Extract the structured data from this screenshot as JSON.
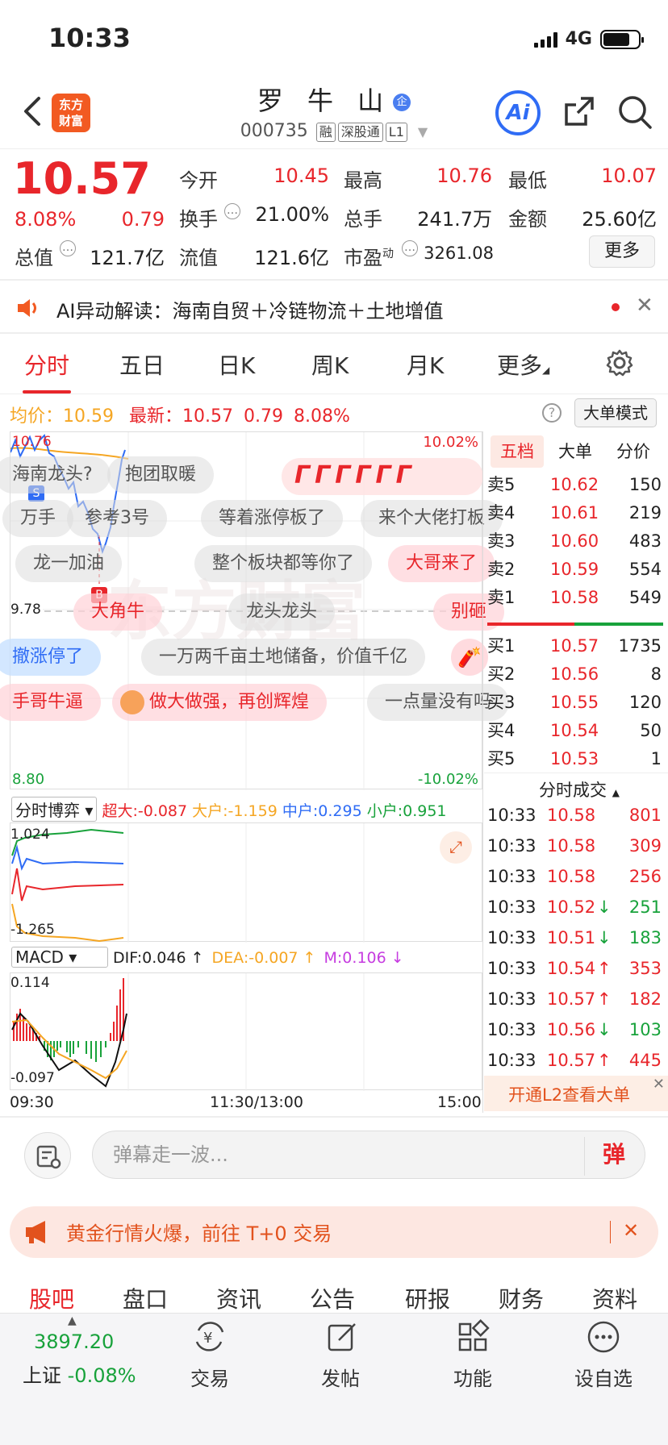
{
  "status": {
    "time": "10:33",
    "network": "4G"
  },
  "header": {
    "title": "罗 牛 山",
    "title_badge": "企",
    "code": "000735",
    "tags": [
      "融",
      "深股通",
      "L1"
    ],
    "logo_text_1": "东方",
    "logo_text_2": "财富",
    "ai_label": "Ai"
  },
  "quote": {
    "price": "10.57",
    "change_pct": "8.08%",
    "change": "0.79",
    "open_label": "今开",
    "open": "10.45",
    "high_label": "最高",
    "high": "10.76",
    "low_label": "最低",
    "low": "10.07",
    "turnover_label": "换手",
    "turnover": "21.00%",
    "volume_label": "总手",
    "volume": "241.7万",
    "amount_label": "金额",
    "amount": "25.60亿",
    "mktcap_label": "总值",
    "mktcap": "121.7亿",
    "float_label": "流值",
    "float": "121.6亿",
    "pe_label": "市盈",
    "pe_sup": "动",
    "pe": "3261.08",
    "more": "更多"
  },
  "ai_bar": {
    "text": "AI异动解读：海南自贸＋冷链物流＋土地增值"
  },
  "ktabs": [
    "分时",
    "五日",
    "日K",
    "周K",
    "月K",
    "更多"
  ],
  "avg": {
    "avg_label": "均价：",
    "avg": "10.59",
    "last_label": "最新：",
    "last": "10.57",
    "chg": "0.79",
    "pct": "8.08%",
    "big_mode": "大单模式"
  },
  "chart": {
    "high_label": "10.76",
    "up_limit": "10.02%",
    "prev_close": "9.78",
    "low_label": "8.80",
    "down_limit": "-10.02%",
    "markers": [
      "S",
      "B"
    ]
  },
  "danmu": [
    "海南龙头?",
    "抱团取暖",
    "万手",
    "参考3号",
    "等着涨停板了",
    "来个大佬打板",
    "龙一加油",
    "整个板块都等你了",
    "大哥来了",
    "大角牛",
    "龙头龙头",
    "别砸",
    "撤涨停了",
    "一万两千亩土地储备，价值千亿",
    "手哥牛逼",
    "做大做强，再创辉煌",
    "一点量没有吗"
  ],
  "orderbook": {
    "tabs": [
      "五档",
      "大单",
      "分价"
    ],
    "asks": [
      {
        "label": "卖5",
        "price": "10.62",
        "vol": "150"
      },
      {
        "label": "卖4",
        "price": "10.61",
        "vol": "219"
      },
      {
        "label": "卖3",
        "price": "10.60",
        "vol": "483"
      },
      {
        "label": "卖2",
        "price": "10.59",
        "vol": "554"
      },
      {
        "label": "卖1",
        "price": "10.58",
        "vol": "549"
      }
    ],
    "bids": [
      {
        "label": "买1",
        "price": "10.57",
        "vol": "1735"
      },
      {
        "label": "买2",
        "price": "10.56",
        "vol": "8"
      },
      {
        "label": "买3",
        "price": "10.55",
        "vol": "120"
      },
      {
        "label": "买4",
        "price": "10.54",
        "vol": "50"
      },
      {
        "label": "买5",
        "price": "10.53",
        "vol": "1"
      }
    ]
  },
  "trades": {
    "title": "分时成交",
    "rows": [
      {
        "time": "10:33",
        "price": "10.58",
        "dir": "",
        "vol": "801",
        "c": "red",
        "vc": "red"
      },
      {
        "time": "10:33",
        "price": "10.58",
        "dir": "",
        "vol": "309",
        "c": "red",
        "vc": "red"
      },
      {
        "time": "10:33",
        "price": "10.58",
        "dir": "",
        "vol": "256",
        "c": "red",
        "vc": "red"
      },
      {
        "time": "10:33",
        "price": "10.52",
        "dir": "↓",
        "vol": "251",
        "c": "red",
        "vc": "green"
      },
      {
        "time": "10:33",
        "price": "10.51",
        "dir": "↓",
        "vol": "183",
        "c": "red",
        "vc": "green"
      },
      {
        "time": "10:33",
        "price": "10.54",
        "dir": "↑",
        "vol": "353",
        "c": "red",
        "vc": "red"
      },
      {
        "time": "10:33",
        "price": "10.57",
        "dir": "↑",
        "vol": "182",
        "c": "red",
        "vc": "red"
      },
      {
        "time": "10:33",
        "price": "10.56",
        "dir": "↓",
        "vol": "103",
        "c": "red",
        "vc": "green"
      },
      {
        "time": "10:33",
        "price": "10.57",
        "dir": "↑",
        "vol": "445",
        "c": "red",
        "vc": "red"
      }
    ],
    "l2": "开通L2查看大单"
  },
  "game": {
    "select": "分时博弈",
    "super": "超大:-0.087",
    "big": "大户:-1.159",
    "mid": "中户:0.295",
    "small": "小户:0.951",
    "max": "1.024",
    "min": "-1.265"
  },
  "macd": {
    "select": "MACD",
    "dif": "DIF:0.046 ↑",
    "dea": "DEA:-0.007 ↑",
    "m": "M:0.106 ↓",
    "max": "0.114",
    "min": "-0.097"
  },
  "time_axis": [
    "09:30",
    "11:30/13:00",
    "15:00"
  ],
  "danmu_input": {
    "placeholder": "弹幕走一波...",
    "send": "弹"
  },
  "promo": {
    "text": "黄金行情火爆，前往 T+0 交易"
  },
  "bottom_tabs": [
    "股吧",
    "盘口",
    "资讯",
    "公告",
    "研报",
    "财务",
    "资料"
  ],
  "bottom_nav": {
    "index_value": "3897.20",
    "index_name": "上证",
    "index_change": "-0.08%",
    "items": [
      "交易",
      "发帖",
      "功能",
      "设自选"
    ]
  },
  "colors": {
    "up": "#e8262b",
    "down": "#18a23b",
    "accent": "#2f6cf5",
    "orange": "#f5a623"
  }
}
